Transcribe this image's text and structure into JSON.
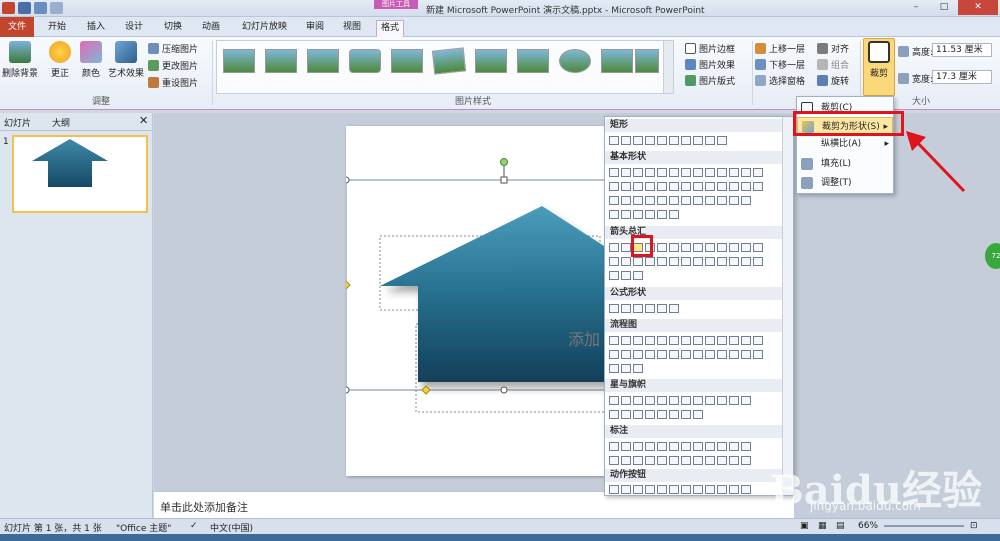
{
  "window": {
    "title": "新建 Microsoft PowerPoint 演示文稿.pptx - Microsoft PowerPoint",
    "context_tools_label": "图片工具",
    "minimize": "–",
    "maximize": "□",
    "close": "✕"
  },
  "tabs": [
    "文件",
    "开始",
    "插入",
    "设计",
    "切换",
    "动画",
    "幻灯片放映",
    "审阅",
    "视图",
    "格式"
  ],
  "ribbon": {
    "adjust": {
      "remove_bg": "删除背景",
      "correct": "更正",
      "color": "颜色",
      "art_effect": "艺术效果",
      "compress": "压缩图片",
      "change": "更改图片",
      "reset": "重设图片",
      "label": "调整"
    },
    "styles": {
      "border": "图片边框",
      "effect": "图片效果",
      "layout": "图片版式",
      "label": "图片样式"
    },
    "arrange": {
      "bring_forward": "上移一层",
      "send_backward": "下移一层",
      "selection_pane": "选择窗格",
      "align": "对齐",
      "group": "组合",
      "rotate": "旋转"
    },
    "size": {
      "crop": "裁剪",
      "height_label": "高度:",
      "height_value": "11.53 厘米",
      "width_label": "宽度:",
      "width_value": "17.3 厘米",
      "label": "大小"
    }
  },
  "left_pane": {
    "tab_slides": "幻灯片",
    "tab_outline": "大纲",
    "slide_number": "1",
    "close": "✕"
  },
  "slide": {
    "placeholder_fragment": "添加"
  },
  "notes": {
    "placeholder": "单击此处添加备注"
  },
  "status": {
    "slide_info": "幻灯片 第 1 张，共 1 张",
    "theme": "\"Office 主题\"",
    "language": "中文(中国)",
    "zoom": "66%"
  },
  "crop_menu": {
    "items": [
      "裁剪(C)",
      "裁剪为形状(S)",
      "纵横比(A)",
      "填充(L)",
      "调整(T)"
    ]
  },
  "shape_menu": {
    "sections": [
      "矩形",
      "基本形状",
      "箭头总汇",
      "公式形状",
      "流程图",
      "星与旗帜",
      "标注",
      "动作按钮"
    ]
  },
  "watermark": {
    "main": "Baidu经验",
    "sub": "jingyan.baidu.com"
  },
  "green_badge": "72"
}
